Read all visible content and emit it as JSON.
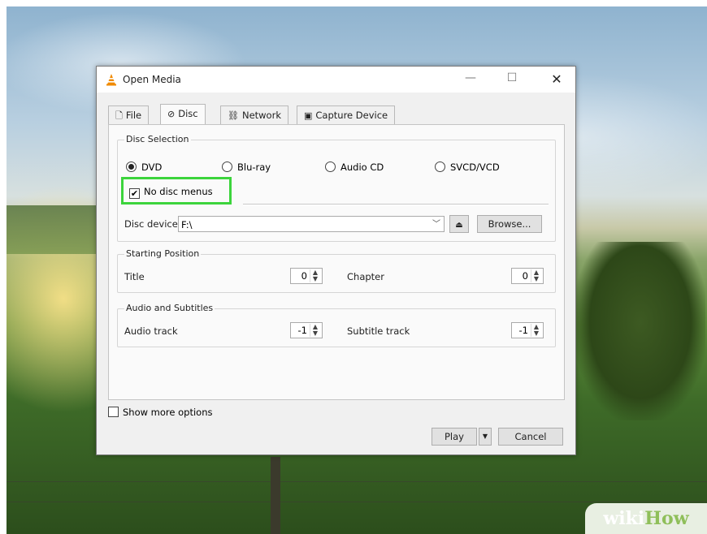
{
  "window": {
    "title": "Open Media",
    "controls": {
      "minimize": "—",
      "maximize": "☐",
      "close": "✕"
    }
  },
  "tabs": [
    {
      "label": "File",
      "icon": "file-icon",
      "active": false
    },
    {
      "label": "Disc",
      "icon": "disc-icon",
      "active": true
    },
    {
      "label": "Network",
      "icon": "network-icon",
      "active": false
    },
    {
      "label": "Capture Device",
      "icon": "capture-device-icon",
      "active": false
    }
  ],
  "disc_selection": {
    "legend": "Disc Selection",
    "options": [
      {
        "label": "DVD",
        "selected": true
      },
      {
        "label": "Blu-ray",
        "selected": false
      },
      {
        "label": "Audio CD",
        "selected": false
      },
      {
        "label": "SVCD/VCD",
        "selected": false
      }
    ],
    "no_disc_menus": {
      "label": "No disc menus",
      "checked": true
    },
    "device_label": "Disc device",
    "device_value": "F:\\",
    "browse_label": "Browse..."
  },
  "starting_position": {
    "legend": "Starting Position",
    "title_label": "Title",
    "title_value": "0",
    "chapter_label": "Chapter",
    "chapter_value": "0"
  },
  "audio_subtitles": {
    "legend": "Audio and Subtitles",
    "audio_label": "Audio track",
    "audio_value": "-1",
    "subtitle_label": "Subtitle track",
    "subtitle_value": "-1"
  },
  "show_more": {
    "label": "Show more options",
    "checked": false
  },
  "footer": {
    "play_label": "Play",
    "cancel_label": "Cancel"
  },
  "watermark": {
    "wiki": "wiki",
    "how": "How"
  },
  "colors": {
    "highlight": "#3cd43c",
    "vlc_orange": "#f08a00"
  }
}
